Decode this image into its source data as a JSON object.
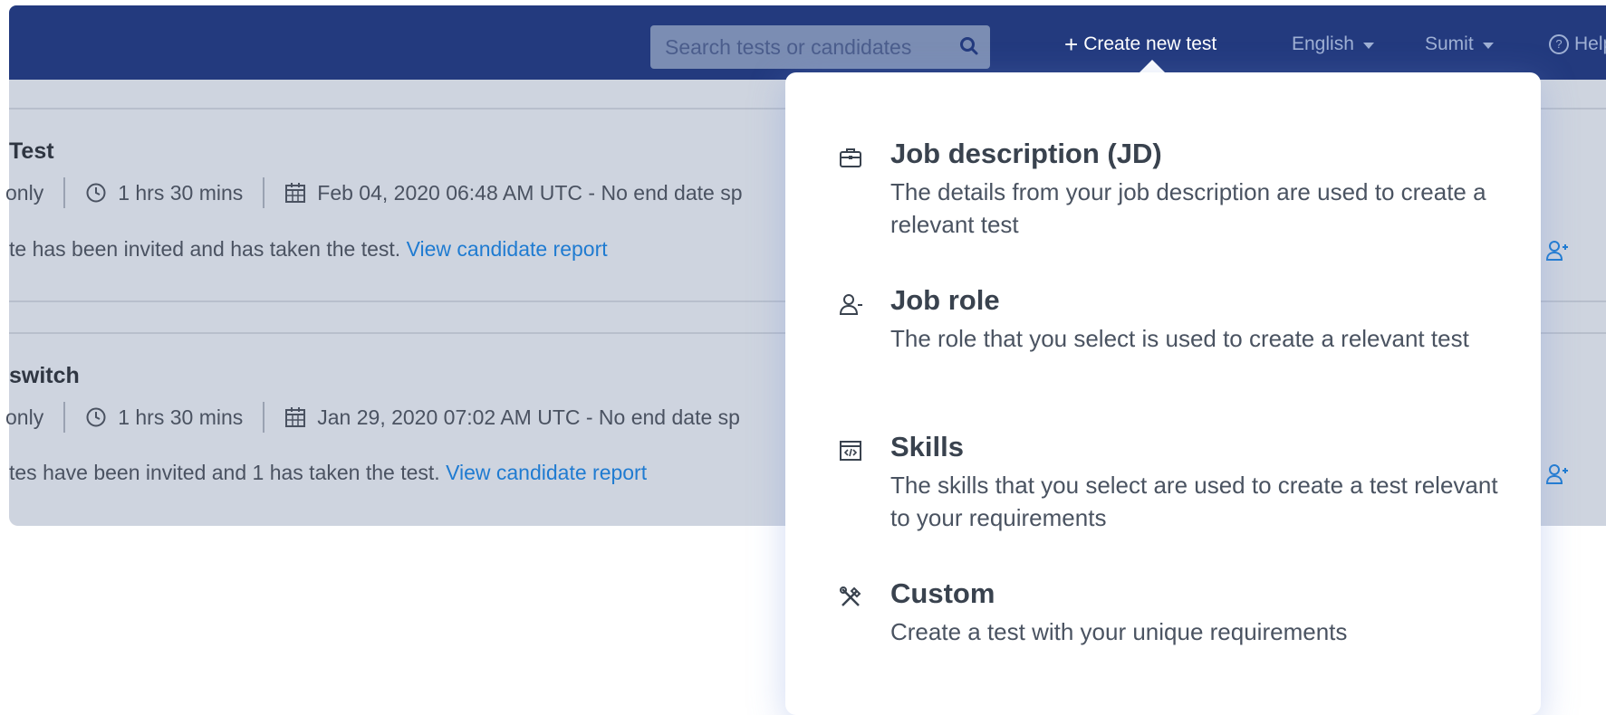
{
  "header": {
    "search_placeholder": "Search tests or candidates",
    "create_label": "Create new test",
    "language": "English",
    "user": "Sumit",
    "help": "Help"
  },
  "tests": [
    {
      "title_fragment": "Test",
      "access_fragment": "only",
      "duration": "1 hrs 30 mins",
      "schedule": "Feb 04, 2020 06:48 AM UTC - No end date sp",
      "status_fragment": "te has been invited and has taken the test.",
      "report_link": "View candidate report"
    },
    {
      "title_fragment": "switch",
      "access_fragment": "only",
      "duration": "1 hrs 30 mins",
      "schedule": "Jan 29, 2020 07:02 AM UTC - No end date sp",
      "status_fragment": "tes have been invited and 1 has taken the test.",
      "report_link": "View candidate report"
    }
  ],
  "create_menu": {
    "options": [
      {
        "icon": "briefcase-icon",
        "title": "Job description (JD)",
        "desc": "The details from your job description are used to create a relevant test"
      },
      {
        "icon": "user-role-icon",
        "title": "Job role",
        "desc": "The role that you select is used to create a relevant test"
      },
      {
        "icon": "code-window-icon",
        "title": "Skills",
        "desc": "The skills that you select are used to create a test relevant to your requirements"
      },
      {
        "icon": "tools-icon",
        "title": "Custom",
        "desc": "Create a test with your unique requirements"
      }
    ]
  },
  "colors": {
    "navbar": "#233a7e",
    "link": "#1f7bd1",
    "overlay": "#ced4df"
  }
}
